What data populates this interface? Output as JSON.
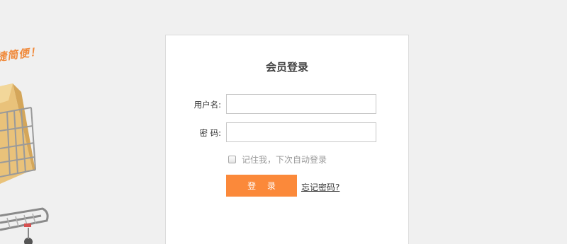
{
  "promo": {
    "slogan": "捷简便！",
    "icon": "shopping-cart-icon",
    "accent_color": "#f08a3c"
  },
  "login": {
    "title": "会员登录",
    "username_label": "用户名:",
    "username_value": "",
    "password_label": "密 码:",
    "password_value": "",
    "remember_label": "记住我，下次自动登录",
    "remember_checked": false,
    "submit_label": "登 录",
    "forgot_label": "忘记密码?",
    "button_color": "#fb893a"
  }
}
